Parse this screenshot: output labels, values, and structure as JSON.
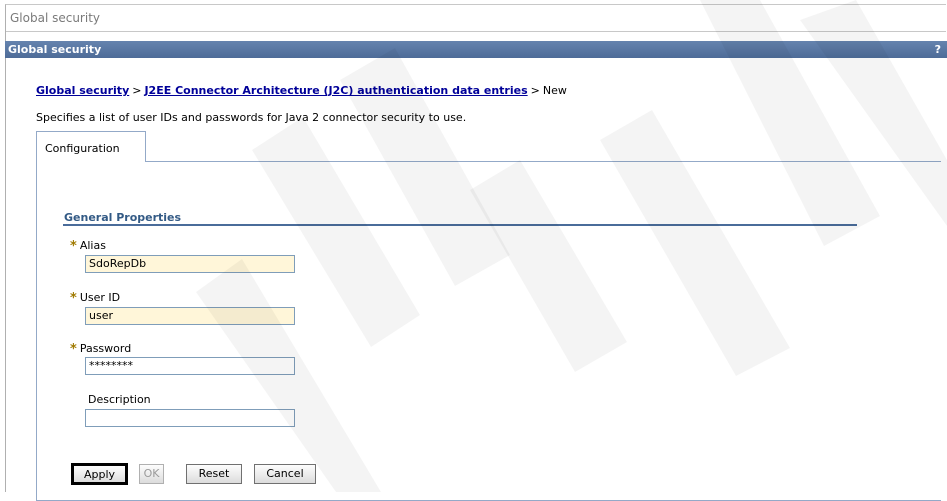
{
  "window": {
    "title": "Global security"
  },
  "portlet": {
    "header": "Global security",
    "help_glyph": "?"
  },
  "breadcrumb": {
    "root": "Global security",
    "separator": ">",
    "parent": "J2EE Connector Architecture (J2C) authentication data entries",
    "current": "New"
  },
  "description": "Specifies a list of user IDs and passwords for Java 2 connector security to use.",
  "tabs": [
    {
      "label": "Configuration",
      "selected": true
    }
  ],
  "section": {
    "title": "General Properties"
  },
  "fields": {
    "required_marker": "*",
    "alias": {
      "label": "Alias",
      "value": "SdoRepDb",
      "required": true
    },
    "user_id": {
      "label": "User ID",
      "value": "user",
      "required": true
    },
    "password": {
      "label": "Password",
      "value": "********",
      "required": true
    },
    "description": {
      "label": "Description",
      "value": "",
      "required": false
    }
  },
  "buttons": {
    "apply": "Apply",
    "ok": "OK",
    "reset": "Reset",
    "cancel": "Cancel"
  },
  "colors": {
    "header_bg": "#5676a4",
    "link": "#000099",
    "section_title": "#335a85",
    "required_marker": "#a07a00",
    "required_field_bg": "#fff6d9",
    "tab_border": "#93a9c8"
  },
  "icons": {
    "help": "help-icon",
    "required": "required-asterisk-icon"
  }
}
